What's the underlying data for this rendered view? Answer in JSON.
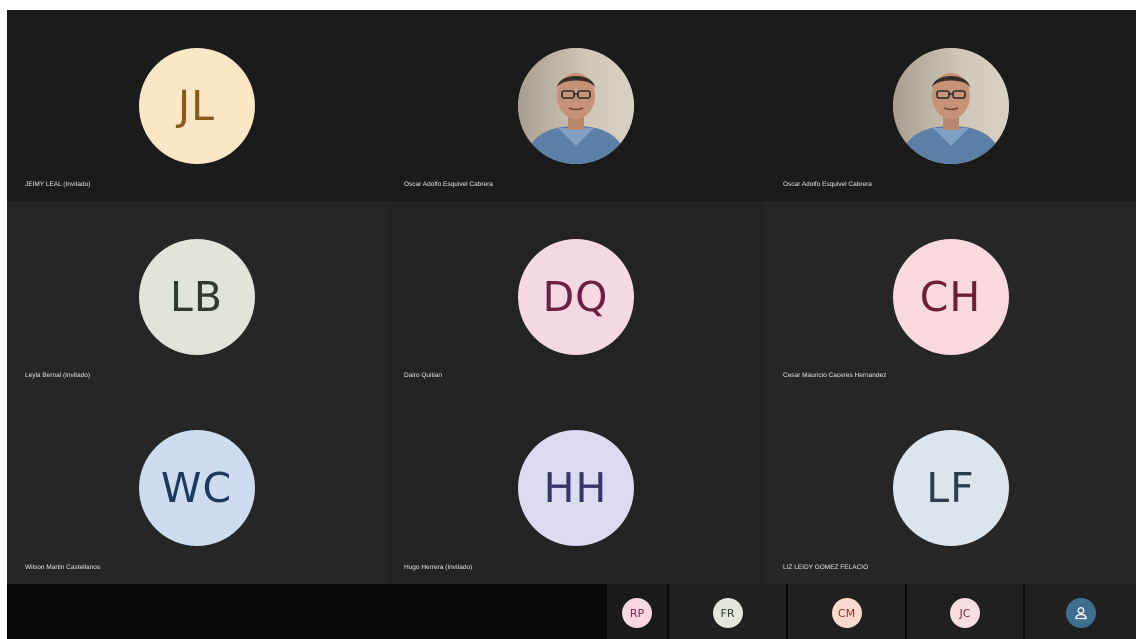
{
  "tiles": [
    {
      "name": "JEIMY LEAL (Invitado)",
      "initials": "JL",
      "type": "initials",
      "avatar_bg": "#fbe7c6",
      "avatar_fg": "#8b5a1b"
    },
    {
      "name": "Oscar Adolfo Esquivel Cabrera",
      "initials": "",
      "type": "photo"
    },
    {
      "name": "Oscar Adolfo Esquivel Cabrera",
      "initials": "",
      "type": "photo"
    },
    {
      "name": "Leyla Bernal (Invitado)",
      "initials": "LB",
      "type": "initials",
      "avatar_bg": "#e1e4da",
      "avatar_fg": "#2f3a28"
    },
    {
      "name": "Dairo Quitian",
      "initials": "DQ",
      "type": "initials",
      "avatar_bg": "#f6d8e4",
      "avatar_fg": "#6b1f45"
    },
    {
      "name": "Cesar Mauricio Caceres Hernandez",
      "initials": "CH",
      "type": "initials",
      "avatar_bg": "#f8d9df",
      "avatar_fg": "#6e1e33"
    },
    {
      "name": "Wilson Martin Castellanos",
      "initials": "WC",
      "type": "initials",
      "avatar_bg": "#cddcee",
      "avatar_fg": "#1c3a5e"
    },
    {
      "name": "Hugo Herrera (Invitado)",
      "initials": "HH",
      "type": "initials",
      "avatar_bg": "#dcdbf0",
      "avatar_fg": "#36346b"
    },
    {
      "name": "LIZ LEIDY GOMEZ FELACIO",
      "initials": "LF",
      "type": "initials",
      "avatar_bg": "#dce5ec",
      "avatar_fg": "#2e3e4c"
    }
  ],
  "overflow": [
    {
      "initials": "RP",
      "avatar_bg": "#f7d7e2",
      "avatar_fg": "#8a2350"
    },
    {
      "initials": "FR",
      "avatar_bg": "#e2e6dc",
      "avatar_fg": "#34402c"
    },
    {
      "initials": "CM",
      "avatar_bg": "#fbd9cf",
      "avatar_fg": "#8a3520"
    },
    {
      "initials": "JC",
      "avatar_bg": "#f8dde3",
      "avatar_fg": "#7a2d44"
    },
    {
      "initials": "",
      "avatar_bg": "#3f6f90",
      "avatar_fg": "#ffffff",
      "icon": "person-icon"
    }
  ]
}
